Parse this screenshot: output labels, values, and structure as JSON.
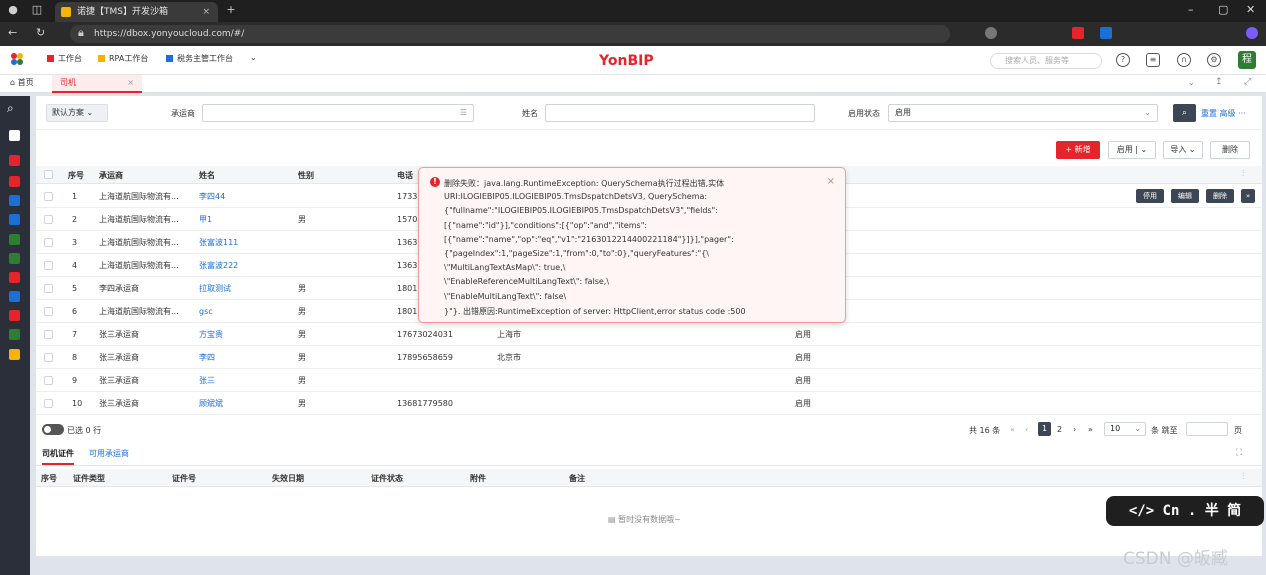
{
  "browser": {
    "tab_title": "诺捷【TMS】开发沙箱",
    "tab_close": "×",
    "new_tab": "+",
    "url": "https://dbox.yonyoucloud.com/#/"
  },
  "app": {
    "workbenches": [
      "工作台",
      "RPA工作台",
      "税务主管工作台"
    ],
    "workbench_colors": [
      "#e5242b",
      "#f4b400",
      "#1a6fd8"
    ],
    "logo": "YonBIP",
    "search_placeholder": "搜索人员、服务等",
    "user_avatar": "程",
    "home_tab": "首页",
    "active_tab": "司机",
    "active_tab_close": "×"
  },
  "filter": {
    "scheme": "默认方案",
    "carrier_label": "承运商",
    "name_label": "姓名",
    "status_label": "启用状态",
    "status_value": "启用",
    "reset_more": "重置 高级 ···"
  },
  "toolbar": {
    "new": "+ 新增",
    "enable": "启用",
    "import": "导入",
    "delete": "删除"
  },
  "table": {
    "headers": [
      "序号",
      "承运商",
      "姓名",
      "性别",
      "电话"
    ],
    "rows": [
      {
        "no": "1",
        "carrier": "上海道航国际物流有...",
        "name": "李四44",
        "gender": "",
        "phone": "1733",
        "city": "",
        "status": ""
      },
      {
        "no": "2",
        "carrier": "上海道航国际物流有...",
        "name": "甲1",
        "gender": "男",
        "phone": "1570",
        "city": "",
        "status": ""
      },
      {
        "no": "3",
        "carrier": "上海道航国际物流有...",
        "name": "张富波111",
        "gender": "",
        "phone": "1363",
        "city": "",
        "status": ""
      },
      {
        "no": "4",
        "carrier": "上海道航国际物流有...",
        "name": "张富波222",
        "gender": "",
        "phone": "1363",
        "city": "",
        "status": ""
      },
      {
        "no": "5",
        "carrier": "李四承运商",
        "name": "拉取测试",
        "gender": "男",
        "phone": "1801",
        "city": "",
        "status": ""
      },
      {
        "no": "6",
        "carrier": "上海道航国际物流有...",
        "name": "gsc",
        "gender": "男",
        "phone": "1801",
        "city": "",
        "status": ""
      },
      {
        "no": "7",
        "carrier": "张三承运商",
        "name": "方宝贵",
        "gender": "男",
        "phone": "17673024031",
        "city": "上海市",
        "status": "启用"
      },
      {
        "no": "8",
        "carrier": "张三承运商",
        "name": "李四",
        "gender": "男",
        "phone": "17895658659",
        "city": "北京市",
        "status": "启用"
      },
      {
        "no": "9",
        "carrier": "张三承运商",
        "name": "张三",
        "gender": "男",
        "phone": "",
        "city": "",
        "status": "启用"
      },
      {
        "no": "10",
        "carrier": "张三承运商",
        "name": "顾斌斌",
        "gender": "男",
        "phone": "13681779580",
        "city": "",
        "status": "启用"
      }
    ],
    "row_actions": [
      "停用",
      "编辑",
      "删除",
      "»"
    ]
  },
  "footer": {
    "selected": "已选 0 行",
    "total": "共 16 条",
    "page1": "1",
    "page2": "2",
    "page_size": "10",
    "per_page": "条 跳至",
    "page_unit": "页"
  },
  "subtabs": [
    "司机证件",
    "可用承运商"
  ],
  "subtable": {
    "headers": [
      "序号",
      "证件类型",
      "证件号",
      "失效日期",
      "证件状态",
      "附件",
      "备注"
    ],
    "empty": "暂时没有数据哦~"
  },
  "error": {
    "lines": [
      "删除失败：java.lang.RuntimeException: QuerySchema执行过程出错,实体",
      "URI:ILOGIEBIP05.ILOGIEBIP05.TmsDspatchDetsV3, QuerySchema:",
      "{\"fullname\":\"ILOGIEBIP05.ILOGIEBIP05.TmsDspatchDetsV3\",\"fields\":",
      "[{\"name\":\"id\"}],\"conditions\":[{\"op\":\"and\",\"items\":",
      "[{\"name\":\"name\",\"op\":\"eq\",\"v1\":\"2163012214400221184\"}]}],\"pager\":",
      "{\"pageIndex\":1,\"pageSize\":1,\"from\":0,\"to\":0},\"queryFeatures\":\"{\\",
      "  \\\"MultiLangTextAsMap\\\": true,\\",
      "  \\\"EnableReferenceMultiLangText\\\": false,\\",
      "  \\\"EnableMultiLangText\\\": false\\",
      "}\"}. 出错原因:RuntimeException of server: HttpClient,error status code :500"
    ],
    "close": "×"
  },
  "badge": "</> Cn . 半 简",
  "watermark": "CSDN @皈臧"
}
